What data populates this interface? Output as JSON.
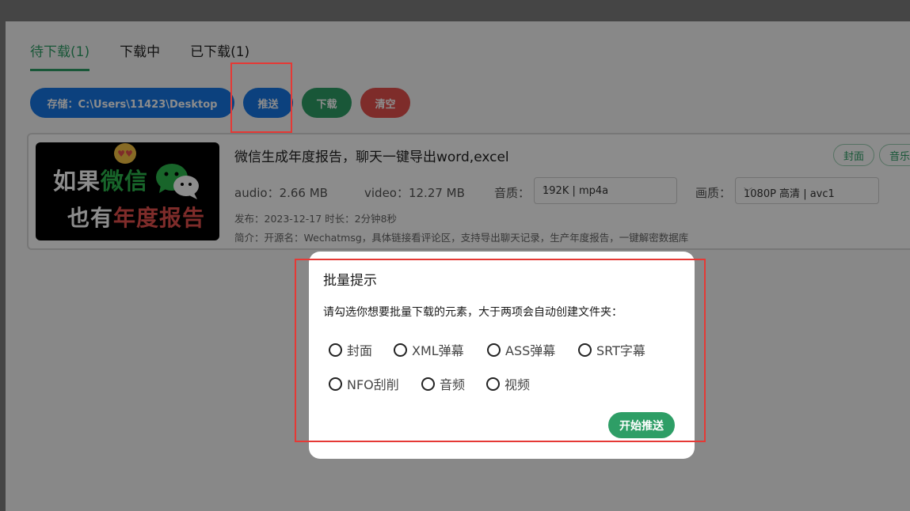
{
  "tabs": [
    {
      "label": "待下载(1)",
      "active": true
    },
    {
      "label": "下载中",
      "active": false
    },
    {
      "label": "已下载(1)",
      "active": false
    }
  ],
  "toolbar": {
    "storage_label": "存储：C:\\Users\\11423\\Desktop",
    "push_label": "推送",
    "download_label": "下载",
    "clear_label": "清空"
  },
  "video": {
    "title": "微信生成年度报告，聊天一键导出word,excel",
    "tags": [
      "封面",
      "音乐"
    ],
    "audio_size": "audio：2.66 MB",
    "video_size": "video：12.27 MB",
    "audio_quality_label": "音质：",
    "audio_quality_value": "192K | mp4a",
    "video_quality_label": "画质：",
    "video_quality_value": "1080P 高清 | avc1",
    "publish_info": "发布：2023-12-17 时长：2分钟8秒",
    "description": "简介：开源名：Wechatmsg，具体链接看评论区，支持导出聊天记录，生产年度报告，一键解密数据库",
    "thumbnail": {
      "line1_white_a": "如果",
      "line1_green": "微信",
      "line2_white": "也有",
      "line2_red": "年度报告"
    }
  },
  "modal": {
    "title": "批量提示",
    "description": "请勾选你想要批量下载的元素，大于两项会自动创建文件夹：",
    "options": [
      "封面",
      "XML弹幕",
      "ASS弹幕",
      "SRT字幕",
      "NFO刮削",
      "音频",
      "视频"
    ],
    "start_label": "开始推送"
  },
  "colors": {
    "accent_green": "#2e9e66",
    "primary_blue": "#1677e6",
    "danger_red": "#e5504e",
    "highlight_red": "#e53935"
  }
}
